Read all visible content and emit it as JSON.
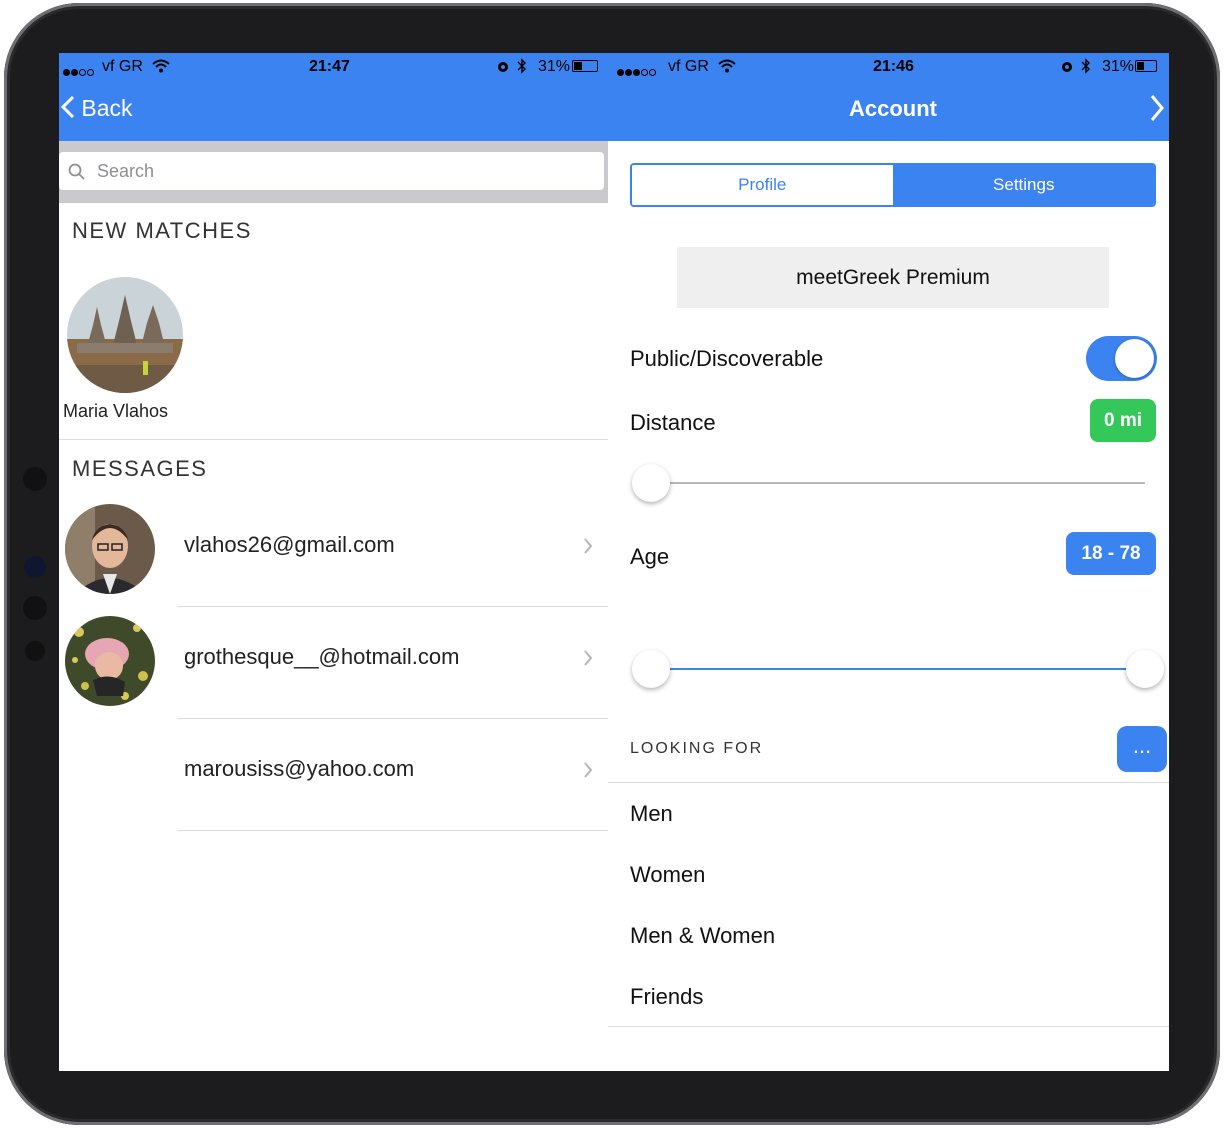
{
  "status_left": {
    "carrier": "vf GR",
    "time": "21:47",
    "battery": "31%"
  },
  "status_right": {
    "carrier": "vf GR",
    "time": "21:46",
    "battery": "31%"
  },
  "nav": {
    "back_label": "Back",
    "title": "Account"
  },
  "search": {
    "placeholder": "Search"
  },
  "new_matches": {
    "heading": "NEW MATCHES",
    "items": [
      {
        "name": "Maria Vlahos"
      }
    ]
  },
  "messages": {
    "heading": "MESSAGES",
    "items": [
      {
        "email": "vlahos26@gmail.com"
      },
      {
        "email": "grothesque__@hotmail.com"
      },
      {
        "email": "marousiss@yahoo.com"
      }
    ]
  },
  "account": {
    "tabs": [
      "Profile",
      "Settings"
    ],
    "selected_tab": "Settings",
    "premium_label": "meetGreek Premium",
    "discoverable": {
      "label": "Public/Discoverable",
      "on": true
    },
    "distance": {
      "label": "Distance",
      "value_text": "0 mi",
      "value": 0
    },
    "age": {
      "label": "Age",
      "value_text": "18 - 78",
      "min": 18,
      "max": 78
    },
    "looking_for": {
      "heading": "LOOKING FOR",
      "more_label": "...",
      "options": [
        "Men",
        "Women",
        "Men & Women",
        "Friends"
      ]
    }
  },
  "colors": {
    "accent": "#3b83f0",
    "distance_badge": "#34c759",
    "navbar": "#3b83f0"
  }
}
